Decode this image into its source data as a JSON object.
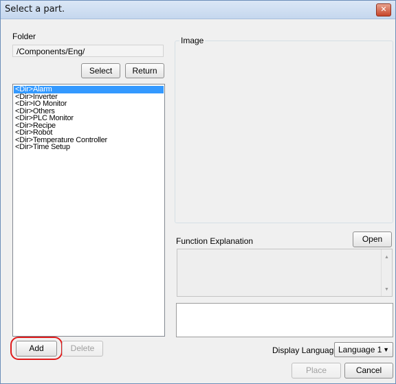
{
  "window": {
    "title": "Select a part.",
    "close_glyph": "✕"
  },
  "folder": {
    "label": "Folder",
    "path": "/Components/Eng/",
    "select_label": "Select",
    "return_label": "Return"
  },
  "parts_list": {
    "items": [
      "<Dir>Alarm",
      "<Dir>Inverter",
      "<Dir>IO Monitor",
      "<Dir>Others",
      "<Dir>PLC Monitor",
      "<Dir>Recipe",
      "<Dir>Robot",
      "<Dir>Temperature Controller",
      "<Dir>Time Setup"
    ],
    "selected_index": 0
  },
  "image_panel": {
    "label": "Image"
  },
  "function_explanation": {
    "label": "Function Explanation",
    "open_label": "Open",
    "scroll_up_glyph": "▲",
    "scroll_down_glyph": "▼"
  },
  "footer": {
    "add_label": "Add",
    "delete_label": "Delete",
    "display_language_label": "Display Language",
    "language_value": "Language 1",
    "language_caret": "▼",
    "place_label": "Place",
    "cancel_label": "Cancel"
  },
  "colors": {
    "selection": "#3399ff",
    "highlight_ring": "#e01a1a"
  }
}
